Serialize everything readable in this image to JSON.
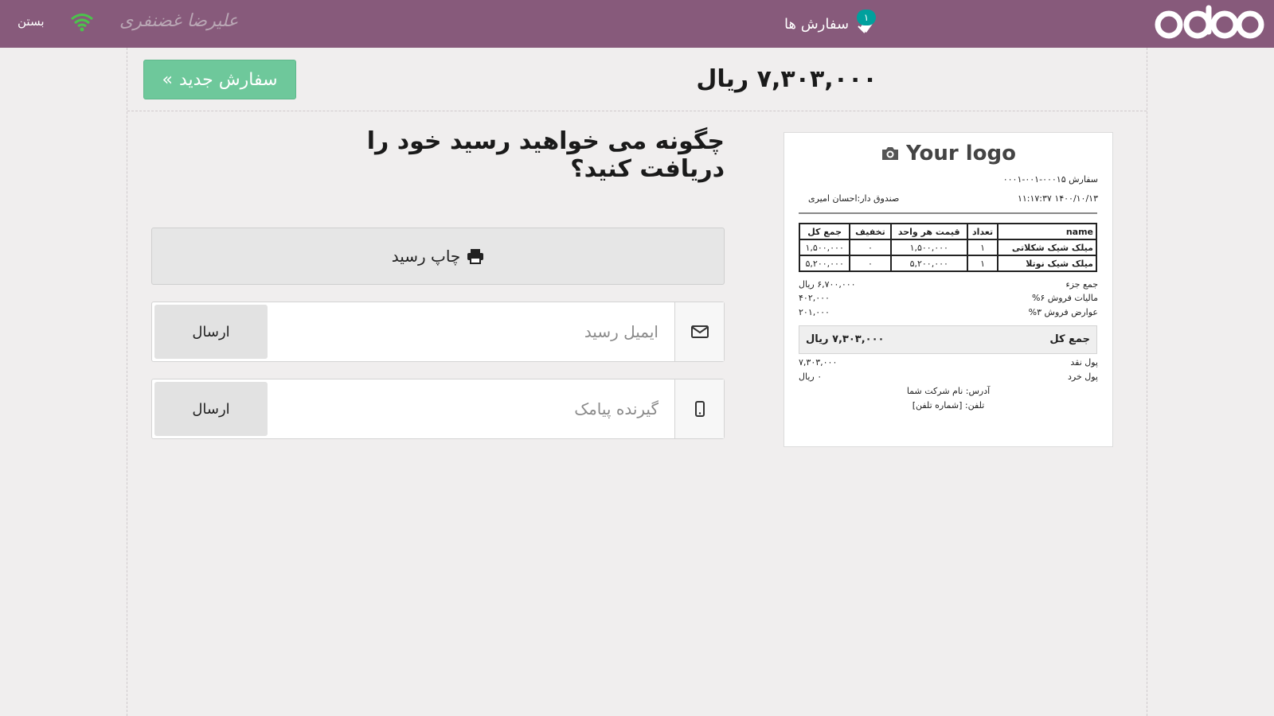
{
  "topbar": {
    "logo_text": "odoo",
    "orders_label": "سفارش ها",
    "orders_badge": "۱",
    "username": "علیرضا غضنفری",
    "close_label": "بستن"
  },
  "header": {
    "total": "۷,۳۰۳,۰۰۰ ریال",
    "new_order_label": "سفارش جدید",
    "new_order_chevron": "»"
  },
  "receipt_options": {
    "question": "چگونه می خواهید رسید خود را دریافت کنید؟",
    "print_label": "چاپ رسید",
    "email_placeholder": "ایمیل رسید",
    "sms_placeholder": "گیرنده پیامک",
    "send_label": "ارسال"
  },
  "receipt": {
    "logo_text": "Your logo",
    "order_ref": "سفارش ۰۰۰۱۵-۰۰۱-۰۰۰۱",
    "datetime": "۱۴۰۰/۱۰/۱۳ ۱۱:۱۷:۳۷",
    "cashier": "صندوق دار:احسان امیری",
    "columns": [
      "name",
      "تعداد",
      "قیمت هر واحد",
      "تخفیف",
      "جمع کل"
    ],
    "rows": [
      [
        "میلک شیک شکلاتی",
        "۱",
        "۱,۵۰۰,۰۰۰",
        "۰",
        "۱,۵۰۰,۰۰۰"
      ],
      [
        "میلک شیک نوتلا",
        "۱",
        "۵,۲۰۰,۰۰۰",
        "۰",
        "۵,۲۰۰,۰۰۰"
      ]
    ],
    "subtotal_label": "جمع جزء",
    "subtotal_value": "۶,۷۰۰,۰۰۰ ریال",
    "tax_label": "مالیات فروش ۶%",
    "tax_value": "۴۰۲,۰۰۰",
    "duty_label": "عوارض فروش ۳%",
    "duty_value": "۲۰۱,۰۰۰",
    "total_label": "جمع کل",
    "total_value": "۷,۳۰۳,۰۰۰ ریال",
    "cash_label": "پول نقد",
    "cash_value": "۷,۳۰۳,۰۰۰",
    "change_label": "پول خرد",
    "change_value": "۰ ریال",
    "address": "آدرس: نام شرکت شما",
    "phone": "تلفن: [شماره تلفن]"
  },
  "colors": {
    "topbar": "#875a7b",
    "new_order": "#6ec89b",
    "badge": "#00a09d",
    "wifi": "#4cc34c"
  }
}
